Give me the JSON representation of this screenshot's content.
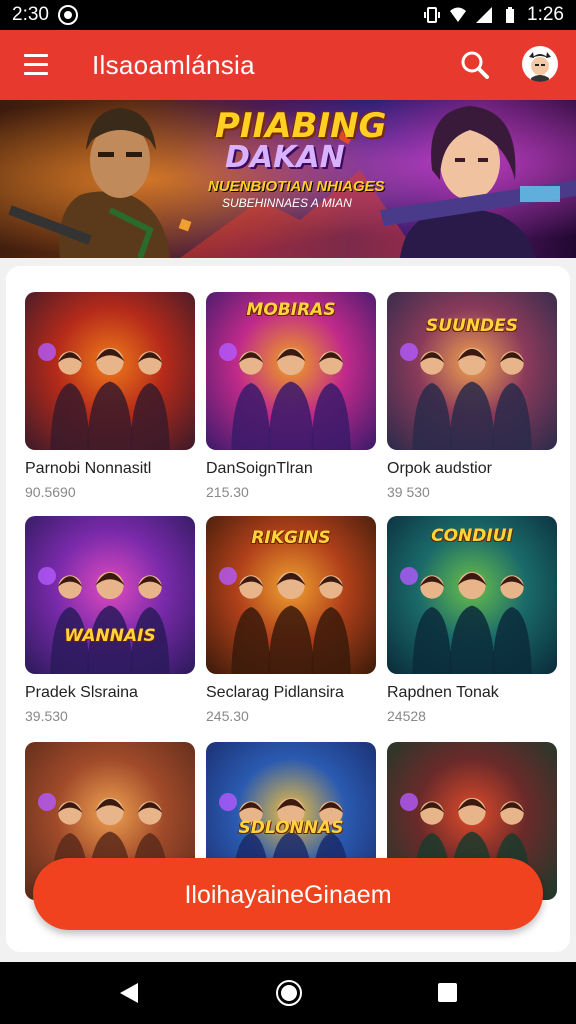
{
  "status_bar": {
    "time": "2:30",
    "clock": "1:26"
  },
  "app_bar": {
    "title": "Ilsaoamlánsia"
  },
  "banner": {
    "title_line1": "PIIABING",
    "title_line2": "DAKAN",
    "subtitle1": "NUENBIOTIAN NHIAGES",
    "subtitle2": "SUBEHINNAES A MIAN"
  },
  "games": [
    {
      "name": "Parnobi Nonnasitl",
      "meta": "90.5690",
      "logo": "",
      "colors": [
        "#3a1a2a",
        "#b52a1a",
        "#f07a1a"
      ]
    },
    {
      "name": "DanSoignTlran",
      "meta": "215.30",
      "logo": "MOBIRAS",
      "colors": [
        "#3a1a6a",
        "#c02a8a",
        "#f0a020"
      ]
    },
    {
      "name": "Orpok audstior",
      "meta": "39 530",
      "logo": "SUUNDES",
      "colors": [
        "#2a2a4a",
        "#8a3a5a",
        "#f0a050"
      ]
    },
    {
      "name": "Pradek Slsraina",
      "meta": "39.530",
      "logo": "WANNAIS",
      "colors": [
        "#2a1a5a",
        "#7a2aaa",
        "#e04ac0"
      ]
    },
    {
      "name": "Seclarag Pidlansira",
      "meta": "245.30",
      "logo": "RIKGINS",
      "colors": [
        "#3a1a0a",
        "#b0401a",
        "#f0a030"
      ]
    },
    {
      "name": "Rapdnen Tonak",
      "meta": "24528",
      "logo": "CONDIUI",
      "colors": [
        "#0a2a3a",
        "#1a6a6a",
        "#6ac04a"
      ]
    },
    {
      "name": "",
      "meta": "",
      "logo": "",
      "colors": [
        "#5a2a1a",
        "#a04a2a",
        "#f0a050"
      ]
    },
    {
      "name": "",
      "meta": "",
      "logo": "SDLONNAS",
      "colors": [
        "#1a2a6a",
        "#2a5ab0",
        "#f0c040"
      ]
    },
    {
      "name": "",
      "meta": "",
      "logo": "",
      "colors": [
        "#1a3a2a",
        "#6a2a2a",
        "#e04a2a"
      ]
    }
  ],
  "cta": {
    "label": "IloihayaineGinaem"
  },
  "colors": {
    "accent": "#e8392f",
    "cta": "#f0421e"
  }
}
